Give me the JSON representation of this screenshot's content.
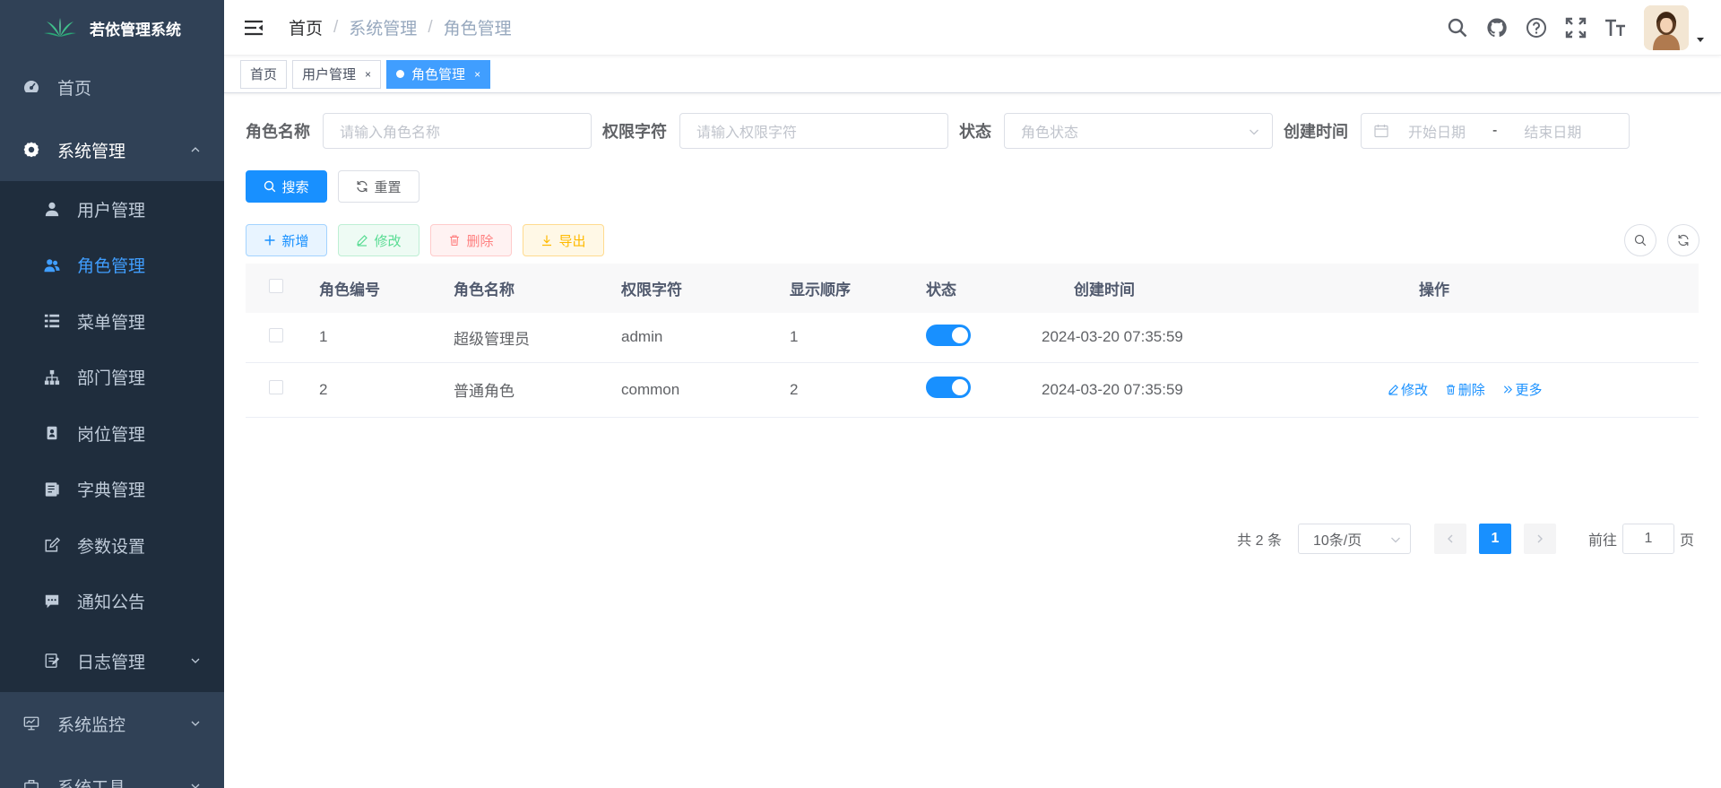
{
  "app": {
    "title": "若依管理系统"
  },
  "sidebar": {
    "items": [
      {
        "label": "首页",
        "icon": "dashboard-icon"
      },
      {
        "label": "系统管理",
        "icon": "gear-icon",
        "expanded": true
      },
      {
        "label": "系统监控",
        "icon": "monitor-icon"
      },
      {
        "label": "系统工具",
        "icon": "tool-icon"
      }
    ],
    "sub_items": [
      {
        "label": "用户管理",
        "icon": "user-icon"
      },
      {
        "label": "角色管理",
        "icon": "peoples-icon",
        "active": true
      },
      {
        "label": "菜单管理",
        "icon": "tree-table-icon"
      },
      {
        "label": "部门管理",
        "icon": "tree-icon"
      },
      {
        "label": "岗位管理",
        "icon": "post-icon"
      },
      {
        "label": "字典管理",
        "icon": "dict-icon"
      },
      {
        "label": "参数设置",
        "icon": "edit-icon"
      },
      {
        "label": "通知公告",
        "icon": "message-icon"
      },
      {
        "label": "日志管理",
        "icon": "log-icon"
      }
    ]
  },
  "breadcrumb": [
    "首页",
    "系统管理",
    "角色管理"
  ],
  "breadcrumb_sep": "/",
  "tags": [
    {
      "label": "首页"
    },
    {
      "label": "用户管理",
      "close": "×"
    },
    {
      "label": "角色管理",
      "close": "×",
      "active": true
    }
  ],
  "search_form": {
    "role_name_label": "角色名称",
    "role_name_placeholder": "请输入角色名称",
    "role_key_label": "权限字符",
    "role_key_placeholder": "请输入权限字符",
    "status_label": "状态",
    "status_placeholder": "角色状态",
    "created_label": "创建时间",
    "start_placeholder": "开始日期",
    "end_placeholder": "结束日期",
    "range_sep": "-",
    "search_btn": "搜索",
    "reset_btn": "重置"
  },
  "toolbar": {
    "add": "新增",
    "edit": "修改",
    "delete": "删除",
    "export": "导出"
  },
  "table": {
    "headers": [
      "角色编号",
      "角色名称",
      "权限字符",
      "显示顺序",
      "状态",
      "创建时间",
      "操作"
    ],
    "rows": [
      {
        "id": "1",
        "name": "超级管理员",
        "key": "admin",
        "sort": "1",
        "status_on": true,
        "created": "2024-03-20 07:35:59"
      },
      {
        "id": "2",
        "name": "普通角色",
        "key": "common",
        "sort": "2",
        "status_on": true,
        "created": "2024-03-20 07:35:59",
        "ops": {
          "edit": "修改",
          "delete": "删除",
          "more": "更多"
        }
      }
    ]
  },
  "pagination": {
    "total": "共 2 条",
    "page_size": "10条/页",
    "current": "1",
    "goto_prefix": "前往",
    "goto_value": "1",
    "goto_suffix": "页"
  },
  "colors": {
    "sidebar_bg": "#304156",
    "submenu_bg": "#1f2d3d",
    "primary": "#1890ff",
    "active_menu": "#409eff"
  }
}
